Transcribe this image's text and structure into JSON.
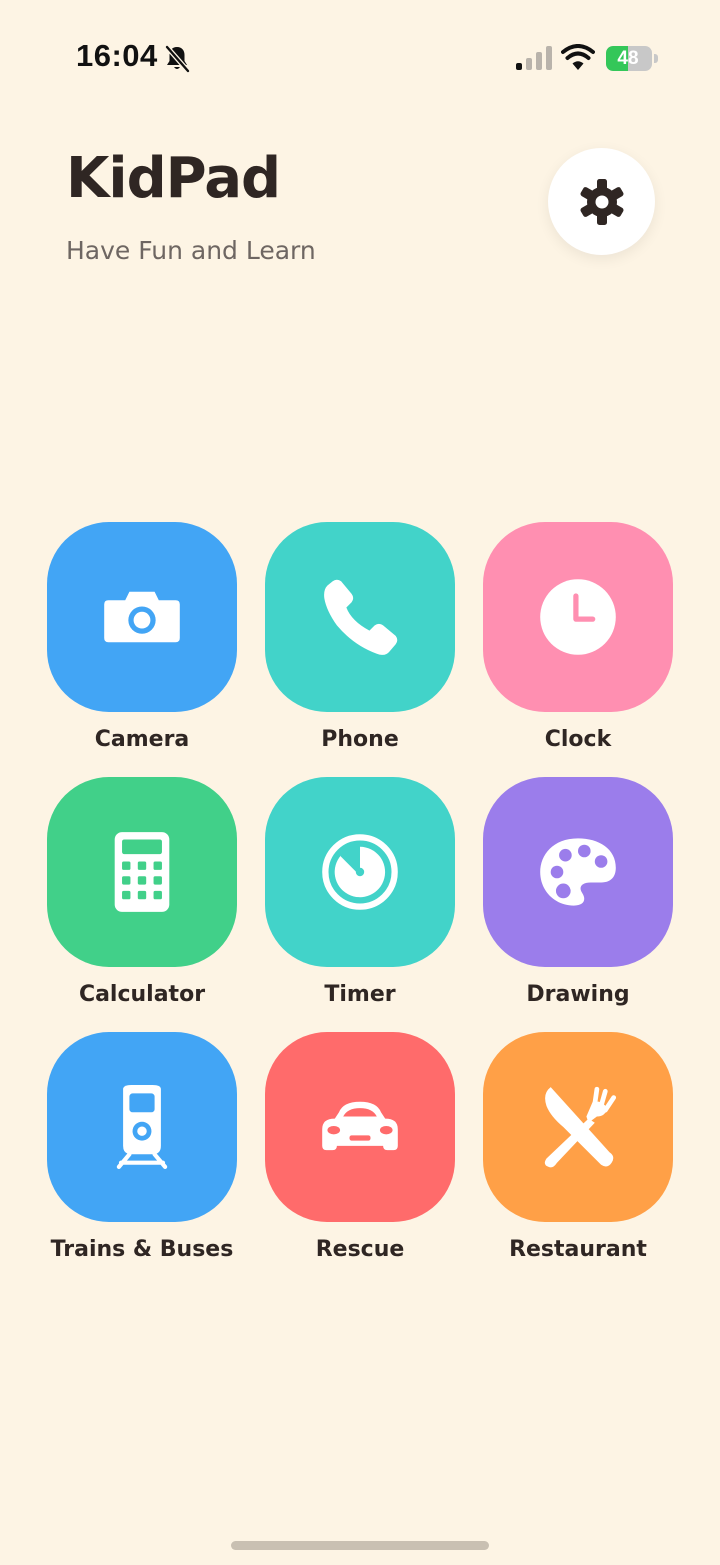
{
  "status_bar": {
    "time": "16:04",
    "battery_percent": "48",
    "battery_level": 0.48,
    "icons": [
      "bell-slash-icon",
      "cellular-signal-icon",
      "wifi-icon",
      "battery-charging-icon"
    ]
  },
  "header": {
    "title": "KidPad",
    "subtitle": "Have Fun and Learn",
    "settings_icon": "gear-icon"
  },
  "apps": [
    {
      "label": "Camera",
      "icon": "camera-icon",
      "color": "#42a5f5"
    },
    {
      "label": "Phone",
      "icon": "phone-icon",
      "color": "#42d3c9"
    },
    {
      "label": "Clock",
      "icon": "clock-icon",
      "color": "#ff8fb1"
    },
    {
      "label": "Calculator",
      "icon": "calculator-icon",
      "color": "#41d089"
    },
    {
      "label": "Timer",
      "icon": "stopwatch-icon",
      "color": "#42d3c9"
    },
    {
      "label": "Drawing",
      "icon": "palette-icon",
      "color": "#9b7deb"
    },
    {
      "label": "Trains & Buses",
      "icon": "train-icon",
      "color": "#42a5f5"
    },
    {
      "label": "Rescue",
      "icon": "car-icon",
      "color": "#ff6b6b"
    },
    {
      "label": "Restaurant",
      "icon": "utensils-icon",
      "color": "#ffa047"
    }
  ],
  "colors": {
    "background": "#fdf4e4",
    "text_primary": "#2f2623",
    "text_secondary": "#6e6662"
  }
}
